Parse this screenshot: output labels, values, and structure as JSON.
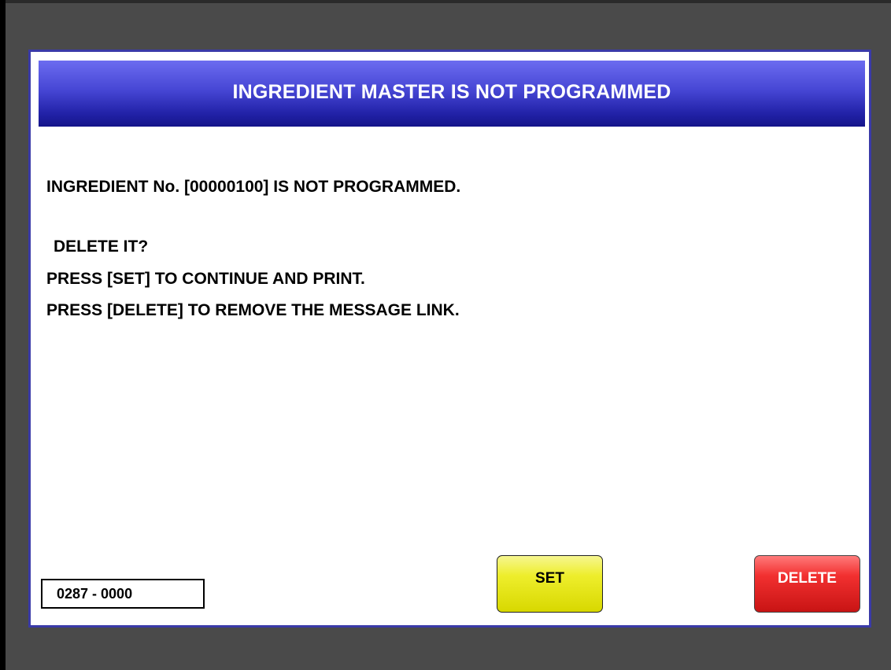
{
  "dialog": {
    "title": "INGREDIENT MASTER IS NOT PROGRAMMED",
    "message_lines": [
      "INGREDIENT No. [00000100] IS NOT PROGRAMMED.",
      "DELETE IT?",
      "PRESS [SET] TO CONTINUE AND PRINT.",
      "PRESS [DELETE] TO REMOVE THE MESSAGE LINK."
    ],
    "code": "0287 - 0000"
  },
  "buttons": {
    "set_label": "SET",
    "delete_label": "DELETE"
  },
  "colors": {
    "title_bar": "#3a3ac8",
    "set_button": "#eeee2c",
    "delete_button": "#f23030",
    "background": "#4a4a4a"
  }
}
